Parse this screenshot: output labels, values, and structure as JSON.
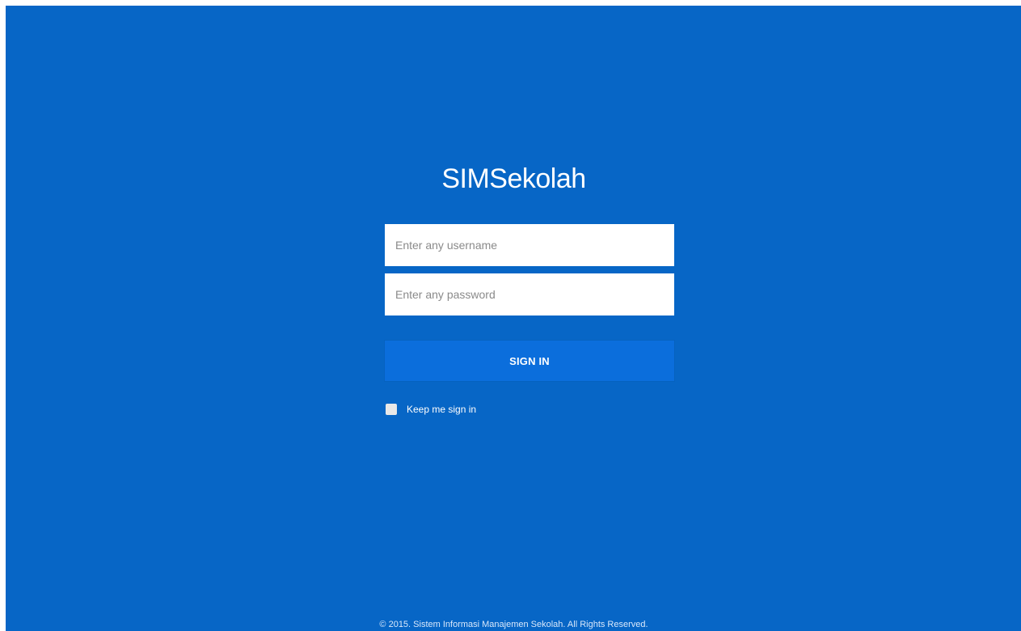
{
  "app": {
    "name": "SIMSekolah"
  },
  "login": {
    "username_placeholder": "Enter any username",
    "username_value": "",
    "password_placeholder": "Enter any password",
    "password_value": "",
    "signin_label": "SIGN IN",
    "remember_label": "Keep me sign in",
    "remember_checked": false
  },
  "footer": {
    "text": "© 2015. Sistem Informasi Manajemen Sekolah. All Rights Reserved."
  },
  "colors": {
    "background": "#0766c6",
    "button": "#0b6edc",
    "text": "#ffffff"
  }
}
